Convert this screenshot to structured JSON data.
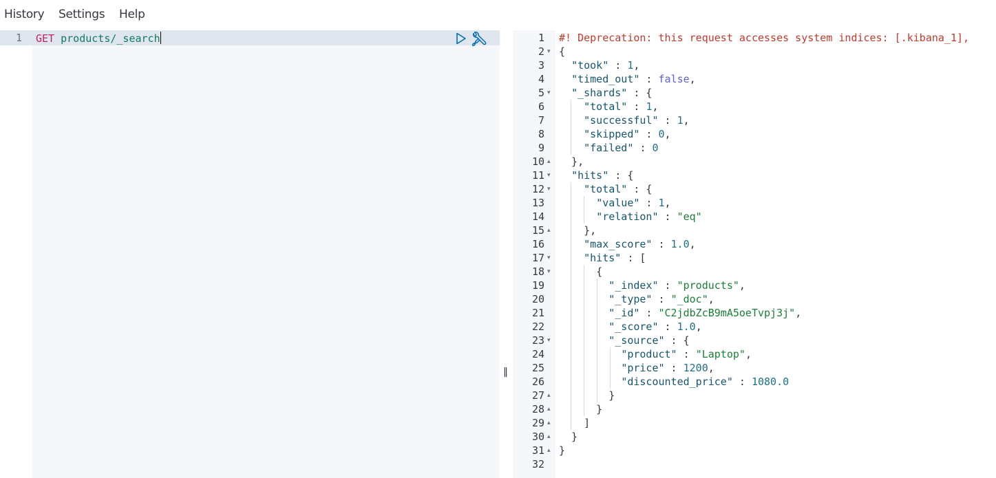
{
  "menu": {
    "items": [
      "History",
      "Settings",
      "Help"
    ]
  },
  "request": {
    "line_number": "1",
    "method": "GET",
    "path": "products/_search",
    "icons": [
      "play-icon",
      "wrench-icon"
    ]
  },
  "divider_icon": "resize-handle-icon",
  "response": {
    "line_numbers": [
      "1",
      "2",
      "3",
      "4",
      "5",
      "6",
      "7",
      "8",
      "9",
      "10",
      "11",
      "12",
      "13",
      "14",
      "15",
      "16",
      "17",
      "18",
      "19",
      "20",
      "21",
      "22",
      "23",
      "24",
      "25",
      "26",
      "27",
      "28",
      "29",
      "30",
      "31",
      "32"
    ],
    "fold_markers": {
      "2": "▾",
      "5": "▾",
      "10": "▴",
      "11": "▾",
      "12": "▾",
      "15": "▴",
      "17": "▾",
      "18": "▾",
      "23": "▾",
      "27": "▴",
      "28": "▴",
      "29": "▴",
      "30": "▴",
      "31": "▴"
    },
    "lines": [
      [
        [
          "#! Deprecation: this request accesses system indices: [.kibana_1],",
          "warn"
        ]
      ],
      [
        [
          "{",
          "p"
        ]
      ],
      [
        [
          "  ",
          "p"
        ],
        [
          "\"took\"",
          "key"
        ],
        [
          " : ",
          "p"
        ],
        [
          "1",
          "num"
        ],
        [
          ",",
          "p"
        ]
      ],
      [
        [
          "  ",
          "p"
        ],
        [
          "\"timed_out\"",
          "key"
        ],
        [
          " : ",
          "p"
        ],
        [
          "false",
          "bool"
        ],
        [
          ",",
          "p"
        ]
      ],
      [
        [
          "  ",
          "p"
        ],
        [
          "\"_shards\"",
          "key"
        ],
        [
          " : {",
          "p"
        ]
      ],
      [
        [
          "    ",
          "p"
        ],
        [
          "\"total\"",
          "key"
        ],
        [
          " : ",
          "p"
        ],
        [
          "1",
          "num"
        ],
        [
          ",",
          "p"
        ]
      ],
      [
        [
          "    ",
          "p"
        ],
        [
          "\"successful\"",
          "key"
        ],
        [
          " : ",
          "p"
        ],
        [
          "1",
          "num"
        ],
        [
          ",",
          "p"
        ]
      ],
      [
        [
          "    ",
          "p"
        ],
        [
          "\"skipped\"",
          "key"
        ],
        [
          " : ",
          "p"
        ],
        [
          "0",
          "num"
        ],
        [
          ",",
          "p"
        ]
      ],
      [
        [
          "    ",
          "p"
        ],
        [
          "\"failed\"",
          "key"
        ],
        [
          " : ",
          "p"
        ],
        [
          "0",
          "num"
        ]
      ],
      [
        [
          "  },",
          "p"
        ]
      ],
      [
        [
          "  ",
          "p"
        ],
        [
          "\"hits\"",
          "key"
        ],
        [
          " : {",
          "p"
        ]
      ],
      [
        [
          "    ",
          "p"
        ],
        [
          "\"total\"",
          "key"
        ],
        [
          " : {",
          "p"
        ]
      ],
      [
        [
          "      ",
          "p"
        ],
        [
          "\"value\"",
          "key"
        ],
        [
          " : ",
          "p"
        ],
        [
          "1",
          "num"
        ],
        [
          ",",
          "p"
        ]
      ],
      [
        [
          "      ",
          "p"
        ],
        [
          "\"relation\"",
          "key"
        ],
        [
          " : ",
          "p"
        ],
        [
          "\"eq\"",
          "str"
        ]
      ],
      [
        [
          "    },",
          "p"
        ]
      ],
      [
        [
          "    ",
          "p"
        ],
        [
          "\"max_score\"",
          "key"
        ],
        [
          " : ",
          "p"
        ],
        [
          "1.0",
          "num"
        ],
        [
          ",",
          "p"
        ]
      ],
      [
        [
          "    ",
          "p"
        ],
        [
          "\"hits\"",
          "key"
        ],
        [
          " : [",
          "p"
        ]
      ],
      [
        [
          "      {",
          "p"
        ]
      ],
      [
        [
          "        ",
          "p"
        ],
        [
          "\"_index\"",
          "key"
        ],
        [
          " : ",
          "p"
        ],
        [
          "\"products\"",
          "str"
        ],
        [
          ",",
          "p"
        ]
      ],
      [
        [
          "        ",
          "p"
        ],
        [
          "\"_type\"",
          "key"
        ],
        [
          " : ",
          "p"
        ],
        [
          "\"_doc\"",
          "str"
        ],
        [
          ",",
          "p"
        ]
      ],
      [
        [
          "        ",
          "p"
        ],
        [
          "\"_id\"",
          "key"
        ],
        [
          " : ",
          "p"
        ],
        [
          "\"C2jdbZcB9mA5oeTvpj3j\"",
          "str"
        ],
        [
          ",",
          "p"
        ]
      ],
      [
        [
          "        ",
          "p"
        ],
        [
          "\"_score\"",
          "key"
        ],
        [
          " : ",
          "p"
        ],
        [
          "1.0",
          "num"
        ],
        [
          ",",
          "p"
        ]
      ],
      [
        [
          "        ",
          "p"
        ],
        [
          "\"_source\"",
          "key"
        ],
        [
          " : {",
          "p"
        ]
      ],
      [
        [
          "          ",
          "p"
        ],
        [
          "\"product\"",
          "key"
        ],
        [
          " : ",
          "p"
        ],
        [
          "\"Laptop\"",
          "str"
        ],
        [
          ",",
          "p"
        ]
      ],
      [
        [
          "          ",
          "p"
        ],
        [
          "\"price\"",
          "key"
        ],
        [
          " : ",
          "p"
        ],
        [
          "1200",
          "num"
        ],
        [
          ",",
          "p"
        ]
      ],
      [
        [
          "          ",
          "p"
        ],
        [
          "\"discounted_price\"",
          "key"
        ],
        [
          " : ",
          "p"
        ],
        [
          "1080.0",
          "num"
        ]
      ],
      [
        [
          "        }",
          "p"
        ]
      ],
      [
        [
          "      }",
          "p"
        ]
      ],
      [
        [
          "    ]",
          "p"
        ]
      ],
      [
        [
          "  }",
          "p"
        ]
      ],
      [
        [
          "}",
          "p"
        ]
      ],
      [
        [
          "",
          "p"
        ]
      ]
    ]
  },
  "colors": {
    "method": "#bd2164",
    "path": "#117a65",
    "warning": "#c0392b",
    "key": "#17566f",
    "number": "#1f6f8b",
    "string": "#1a7f37",
    "boolean": "#5d5fd5",
    "gutter_bg": "#f5f7fa",
    "active_line": "#e0e6ee"
  }
}
